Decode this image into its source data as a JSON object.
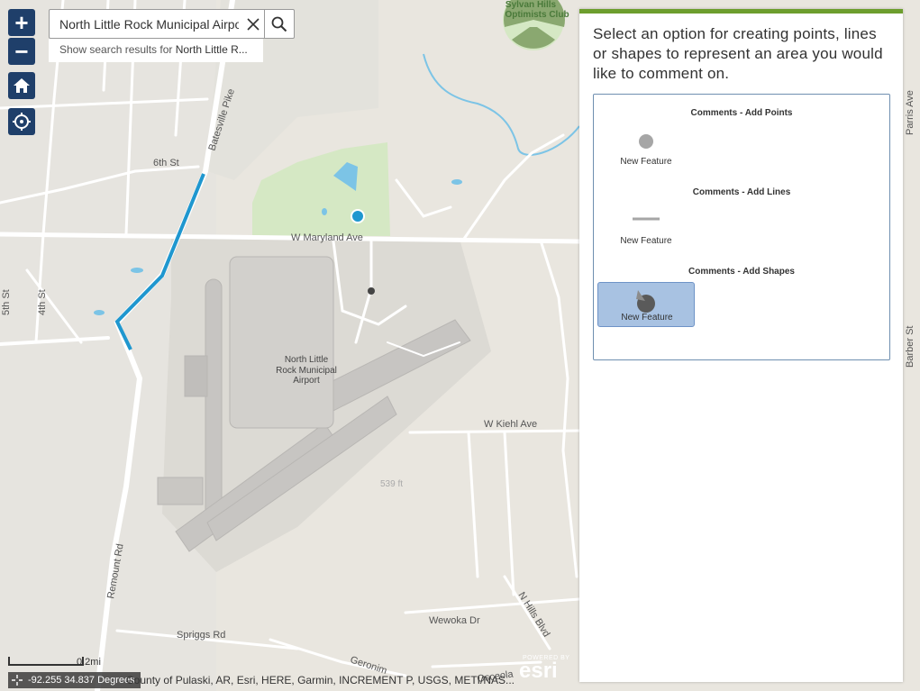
{
  "search": {
    "value": "North Little Rock Municipal Airport",
    "suggestion_prefix": "Show search results for ",
    "suggestion_term": "North Little R..."
  },
  "map_labels": {
    "sylvan_hills": "Sylvan Hills",
    "optimists_club": "Optimists Club",
    "batesville_pike": "Batesville Pike",
    "sixth_st": "6th St",
    "w_maryland_ave": "W Maryland Ave",
    "fifth_st": "5th St",
    "fourth_st": "4th St",
    "airport_l1": "North Little",
    "airport_l2": "Rock Municipal",
    "airport_l3": "Airport",
    "w_kiehl_ave": "W Kiehl Ave",
    "remount_rd": "Remount Rd",
    "spriggs_rd": "Spriggs Rd",
    "wewoka_dr": "Wewoka Dr",
    "n_hills_blvd": "N Hills Blvd",
    "geronimo": "Geronim",
    "osceola": "Osceola",
    "parris_ave": "Parris Ave",
    "barber_st": "Barber St",
    "elev_539": "539 ft"
  },
  "panel": {
    "title": "Select an option for creating points, lines or shapes to represent an area you would like to comment on.",
    "groups": [
      {
        "title": "Comments - Add Points",
        "label": "New Feature"
      },
      {
        "title": "Comments - Add Lines",
        "label": "New Feature"
      },
      {
        "title": "Comments - Add Shapes",
        "label": "New Feature"
      }
    ]
  },
  "scale": {
    "label": "0.2mi"
  },
  "coords": {
    "text": "-92.255 34.837 Degrees"
  },
  "attribution": {
    "text": "County of Pulaski, AR, Esri, HERE, Garmin, INCREMENT P, USGS, METI/NAS..."
  },
  "esri": {
    "powered": "POWERED BY",
    "name": "esri"
  },
  "colors": {
    "route": "#1f97cf",
    "navy": "#1f3f6a",
    "panel_accent": "#6d9e2e",
    "park": "#d5e8c4",
    "water": "#7cc4e6"
  }
}
